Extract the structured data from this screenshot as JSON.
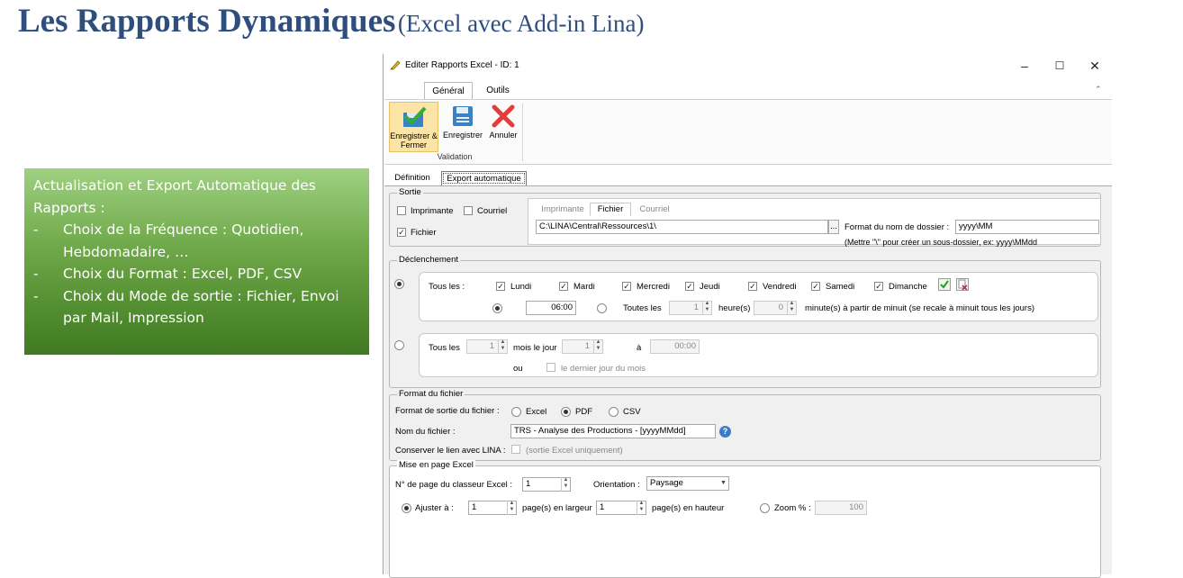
{
  "slide": {
    "title_main": "Les Rapports Dynamiques",
    "title_sub": "(Excel avec Add-in Lina)",
    "callout_intro": "Actualisation et Export Automatique des Rapports :",
    "callout_items": [
      "Choix de la Fréquence : Quotidien, Hebdomadaire, …",
      "Choix du Format : Excel, PDF, CSV",
      "Choix du Mode de sortie : Fichier, Envoi par Mail, Impression"
    ]
  },
  "window": {
    "title": "Editer Rapports Excel - ID: 1",
    "controls": {
      "minimize": "–",
      "maximize": "☐",
      "close": "✕"
    },
    "ribbon_tabs": [
      "Général",
      "Outils"
    ],
    "ribbon_buttons": {
      "save_close": "Enregistrer & Fermer",
      "save": "Enregistrer",
      "cancel": "Annuler"
    },
    "ribbon_group": "Validation",
    "page_tabs": [
      "Définition",
      "Export automatique"
    ]
  },
  "sortie": {
    "title": "Sortie",
    "imprimante": "Imprimante",
    "courriel": "Courriel",
    "fichier": "Fichier",
    "sub_tabs": [
      "Imprimante",
      "Fichier",
      "Courriel"
    ],
    "path": "C:\\LINA\\Central\\Ressources\\1\\",
    "browse": "...",
    "folder_format_label": "Format du nom de dossier :",
    "folder_format_value": "yyyy\\MM",
    "hint": "(Mettre \"\\\" pour créer un sous-dossier, ex: yyyy\\MMdd"
  },
  "declenchement": {
    "title": "Déclenchement",
    "tous_les": "Tous les :",
    "days": [
      "Lundi",
      "Mardi",
      "Mercredi",
      "Jeudi",
      "Vendredi",
      "Samedi",
      "Dimanche"
    ],
    "time_value": "06:00",
    "toutes_les": "Toutes les",
    "hours_value": "1",
    "heures_label": "heure(s)",
    "minutes_value": "0",
    "minutes_label": "minute(s) à partir de minuit (se recale à minuit tous les jours)",
    "tous_les_2": "Tous les",
    "months_value": "1",
    "mois_le_jour": "mois le jour",
    "day_value": "1",
    "a_label": "à",
    "time2_value": "00:00",
    "ou": "ou",
    "last_day": "le dernier jour du mois"
  },
  "format_fichier": {
    "title": "Format du fichier",
    "sortie_label": "Format de sortie du fichier :",
    "options": [
      "Excel",
      "PDF",
      "CSV"
    ],
    "nom_label": "Nom du fichier :",
    "nom_value": "TRS - Analyse des Productions - [yyyyMMdd]",
    "help": "?",
    "lien_label": "Conserver le lien avec LINA :",
    "lien_hint": "(sortie Excel uniquement)"
  },
  "mise_en_page": {
    "title": "Mise en page Excel",
    "page_label": "N° de page du classeur Excel :",
    "page_value": "1",
    "orientation_label": "Orientation :",
    "orientation_value": "Paysage",
    "ajuster_label": "Ajuster à :",
    "largeur_value": "1",
    "largeur_label": "page(s) en largeur",
    "hauteur_value": "1",
    "hauteur_label": "page(s) en hauteur",
    "zoom_label": "Zoom % :",
    "zoom_value": "100"
  }
}
